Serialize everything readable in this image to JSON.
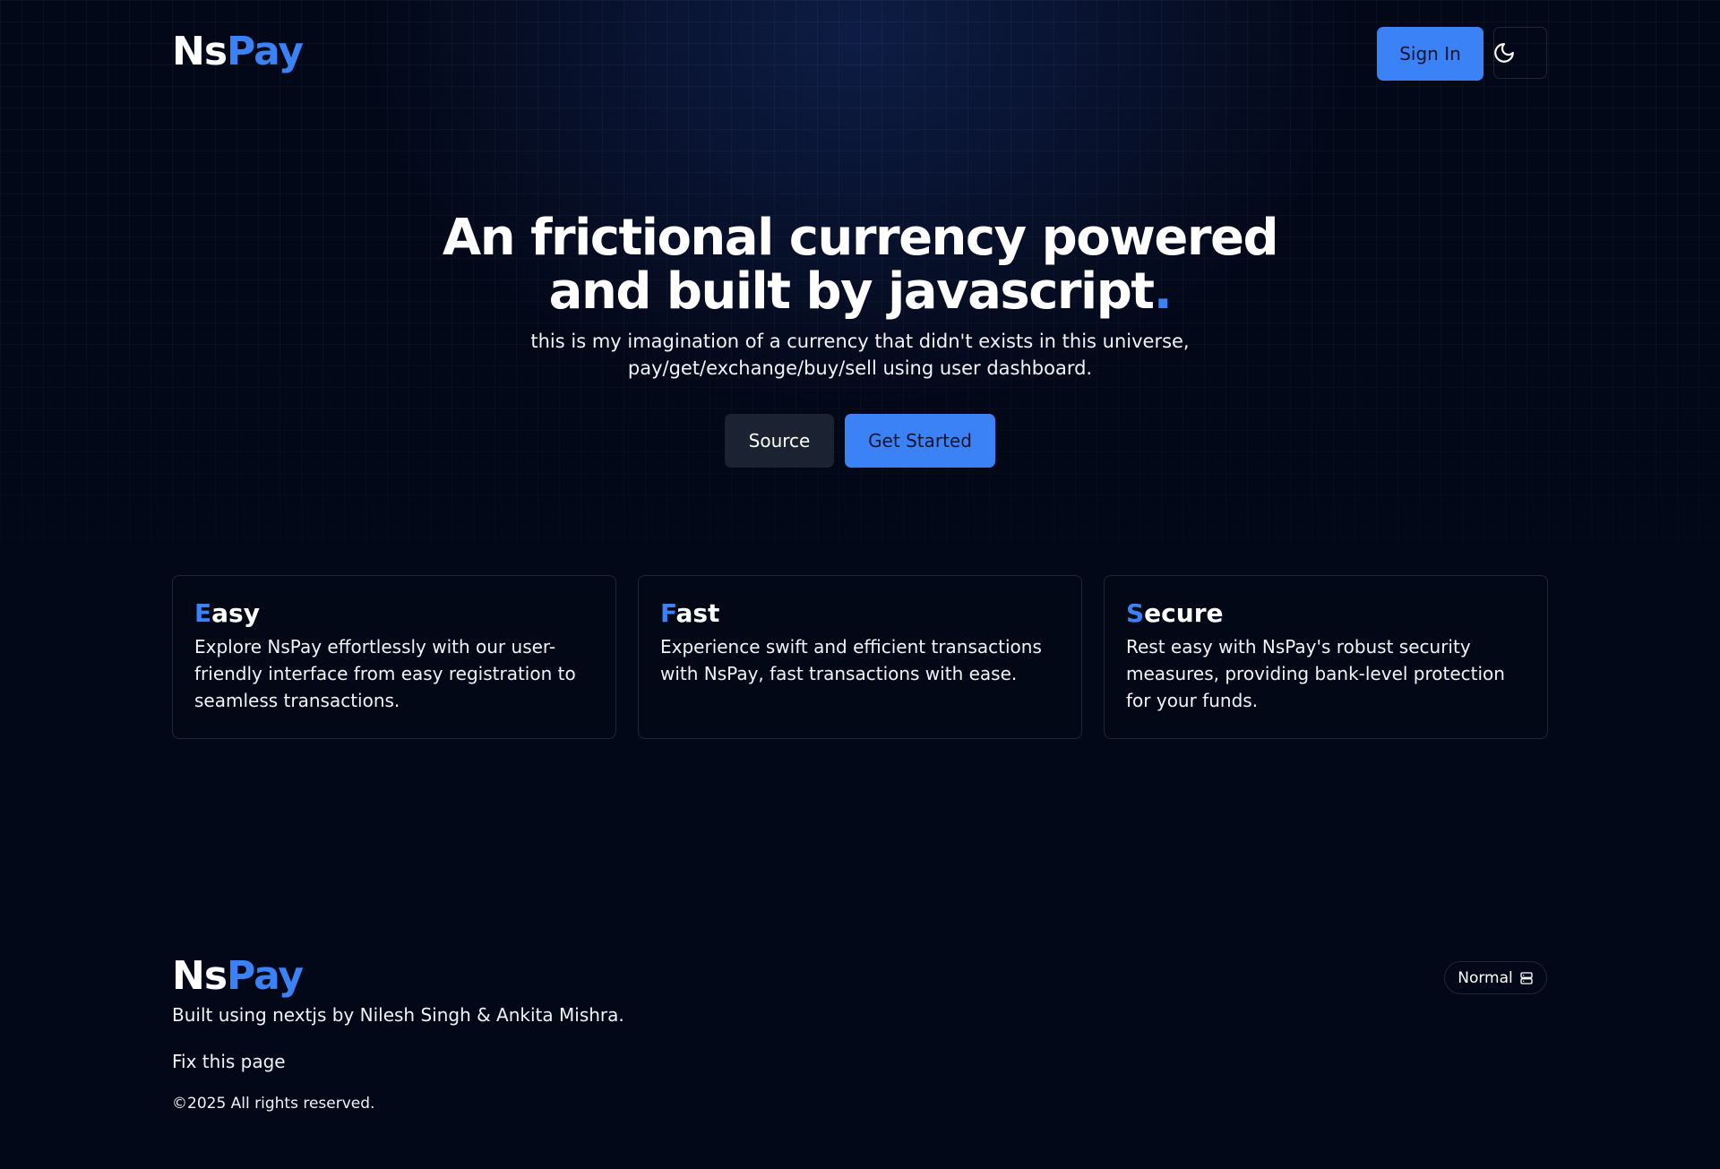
{
  "header": {
    "logo": {
      "part1": "Ns",
      "part2": "Pay"
    },
    "signin_label": "Sign In",
    "theme_toggle_icon": "moon-icon"
  },
  "hero": {
    "title_line1": "An frictional currency powered",
    "title_line2": "and built by javascript",
    "title_dot": ".",
    "subtitle_line1": "this is my imagination of a currency that didn't exists in this universe,",
    "subtitle_line2": "pay/get/exchange/buy/sell using user dashboard.",
    "source_label": "Source",
    "get_started_label": "Get Started"
  },
  "features": [
    {
      "title_first": "E",
      "title_rest": "asy",
      "text": "Explore NsPay effortlessly with our user-friendly interface from easy registration to seamless transactions."
    },
    {
      "title_first": "F",
      "title_rest": "ast",
      "text": "Experience swift and efficient transactions with NsPay, fast transactions with ease."
    },
    {
      "title_first": "S",
      "title_rest": "ecure",
      "text": "Rest easy with NsPay's robust security measures, providing bank-level protection for your funds."
    }
  ],
  "footer": {
    "logo": {
      "part1": "Ns",
      "part2": "Pay"
    },
    "built_by": "Built using nextjs by Nilesh Singh & Ankita Mishra.",
    "fix_link": "Fix this page",
    "copyright": "©2025 All rights reserved.",
    "status_label": "Normal",
    "status_icon": "server-icon"
  },
  "colors": {
    "background": "#030818",
    "accent": "#3b82f6",
    "secondary_button": "#1b2333",
    "border": "#1f2636"
  }
}
